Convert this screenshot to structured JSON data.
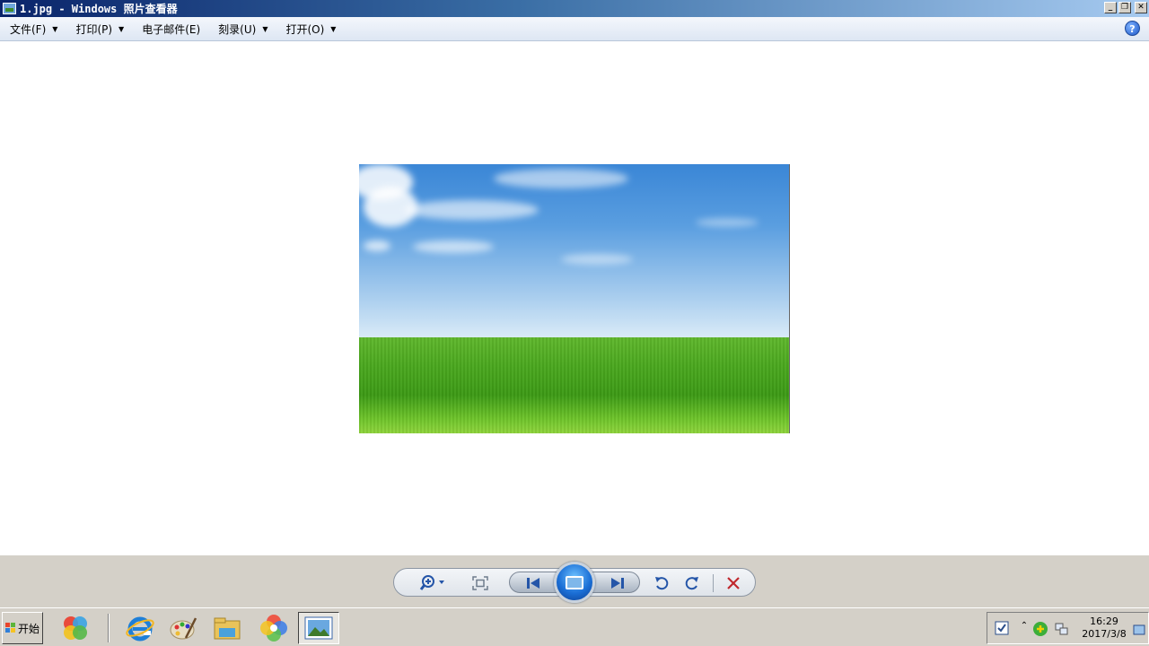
{
  "window": {
    "title": "1.jpg - Windows 照片查看器",
    "controls": {
      "minimize": "_",
      "restore": "❐",
      "close": "✕"
    }
  },
  "menu": {
    "items": [
      {
        "label": "文件(F)",
        "has_dropdown": true
      },
      {
        "label": "打印(P)",
        "has_dropdown": true
      },
      {
        "label": "电子邮件(E)",
        "has_dropdown": false
      },
      {
        "label": "刻录(U)",
        "has_dropdown": true
      },
      {
        "label": "打开(O)",
        "has_dropdown": true
      }
    ],
    "help": "?"
  },
  "viewer_toolbar": {
    "zoom_icon": "zoom-icon",
    "fit_icon": "actual-size-icon",
    "previous_icon": "previous-icon",
    "slideshow_icon": "slideshow-icon",
    "next_icon": "next-icon",
    "rotate_ccw_icon": "rotate-counterclockwise-icon",
    "rotate_cw_icon": "rotate-clockwise-icon",
    "delete_icon": "delete-icon",
    "colors": {
      "icon_blue": "#2455a8",
      "delete_red": "#c0282d"
    }
  },
  "taskbar": {
    "start_label": "开始",
    "clock": {
      "time": "16:29",
      "date": "2017/3/8"
    }
  }
}
